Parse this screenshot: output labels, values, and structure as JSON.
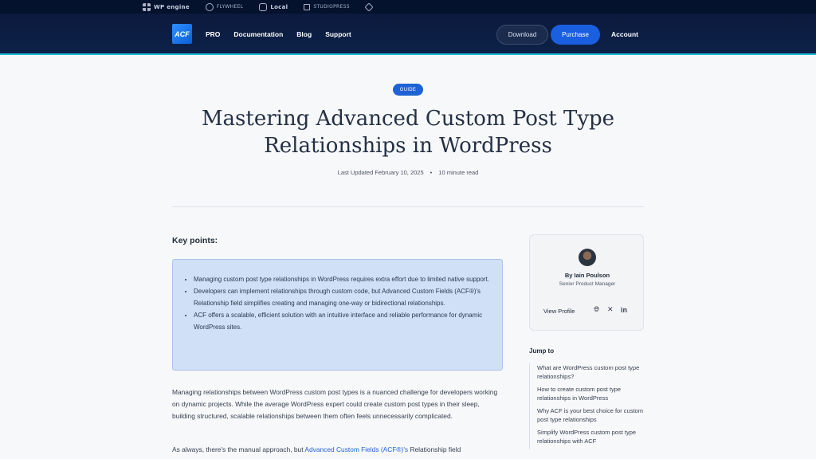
{
  "brandbar": {
    "brands": [
      {
        "icon": "wp-engine-icon",
        "label": "WP engine"
      },
      {
        "icon": "flywheel-icon",
        "label": "FLYWHEEL"
      },
      {
        "icon": "local-icon",
        "label": "Local"
      },
      {
        "icon": "studiopress-icon",
        "label": "STUDIOPRESS"
      },
      {
        "icon": "genesis-icon",
        "label": ""
      }
    ]
  },
  "nav": {
    "logo": "ACF",
    "links": [
      "PRO",
      "Documentation",
      "Blog",
      "Support"
    ],
    "download": "Download",
    "purchase": "Purchase",
    "account": "Account"
  },
  "article": {
    "tag": "GUIDE",
    "title": "Mastering Advanced Custom Post Type Relationships in WordPress",
    "updated": "Last Updated February 10, 2025",
    "dot": "•",
    "read_time": "10 minute read",
    "key_points_title": "Key points:",
    "key_points": [
      "Managing custom post type relationships in WordPress requires extra effort due to limited native support.",
      "Developers can implement relationships through custom code, but Advanced Custom Fields (ACF®)'s Relationship field simplifies creating and managing one-way or bidirectional relationships.",
      "ACF offers a scalable, efficient solution with an intuitive interface and reliable performance for dynamic WordPress sites."
    ],
    "para1": "Managing relationships between WordPress custom post types is a nuanced challenge for developers working on dynamic projects. While the average WordPress expert could create custom post types in their sleep, building structured, scalable relationships between them often feels unnecessarily complicated.",
    "para2_prefix": "As always, there's the manual approach, but ",
    "para2_link": "Advanced Custom Fields (ACF®)'s",
    "para2_suffix": " Relationship field"
  },
  "author": {
    "name": "By Iain Poulson",
    "role": "Senior Product Manager",
    "view_profile": "View Profile",
    "social_icons": [
      "globe-icon",
      "x-icon",
      "linkedin-icon"
    ]
  },
  "jump": {
    "title": "Jump to",
    "items": [
      "What are WordPress custom post type relationships?",
      "How to create custom post type relationships in WordPress",
      "Why ACF is your best choice for custom post type relationships",
      "Simplify WordPress custom post type relationships with ACF"
    ]
  },
  "colors": {
    "nav_bg": "#0b1a3d",
    "accent": "#1e63d6",
    "keybox_bg": "#cfe0f7"
  }
}
